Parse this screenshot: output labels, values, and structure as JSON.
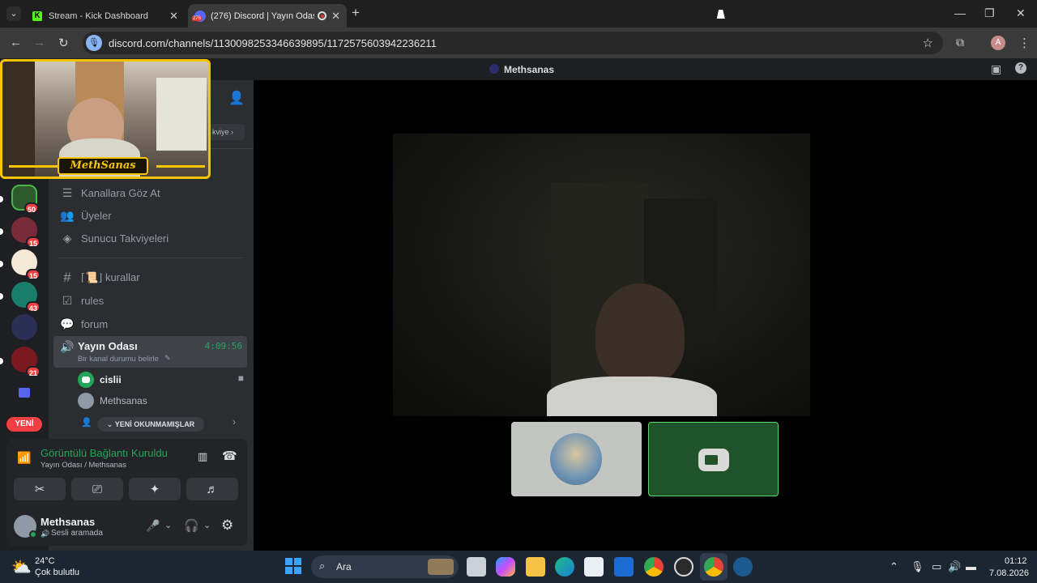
{
  "browser": {
    "tabs": [
      {
        "title": "Stream - Kick Dashboard",
        "active": false
      },
      {
        "title": "(276) Discord | Yayın Odası |",
        "badge": "276",
        "active": true
      }
    ],
    "url": "discord.com/channels/1130098253346639895/1172575603942236211",
    "profile_initial": "A"
  },
  "discord": {
    "header_title": "Methsanas",
    "boost_hint": "kviye",
    "webcam_overlay_label": "MethSanas",
    "guild_badges": [
      "50",
      "15",
      "15",
      "43",
      "21"
    ],
    "new_pill": "YENİ",
    "channels": [
      {
        "icon": "browse-icon",
        "label": "Kanallara Göz At"
      },
      {
        "icon": "members-icon",
        "label": "Üyeler"
      },
      {
        "icon": "boost-icon",
        "label": "Sunucu Takviyeleri"
      },
      {
        "icon": "hash-icon",
        "label": "⌈📜⌋ kurallar"
      },
      {
        "icon": "rules-icon",
        "label": "rules"
      },
      {
        "icon": "forum-icon",
        "label": "forum"
      }
    ],
    "voice_channel": {
      "name": "Yayın Odası",
      "timer": "4:09:56",
      "status_placeholder": "Bir kanal durumu belirle",
      "members": [
        "cislii",
        "Methsanas"
      ]
    },
    "unread_pill": "YENİ OKUNMAMIŞLAR",
    "voice_status": {
      "title": "Görüntülü Bağlantı Kuruldu",
      "subtitle": "Yayın Odası / Methsanas"
    },
    "user": {
      "name": "Methsanas",
      "status": "Sesli aramada"
    },
    "colors": {
      "accent_green": "#23a559",
      "blurple": "#5865f2",
      "danger": "#f23f43",
      "webcam_frame": "#f6c400"
    }
  },
  "taskbar": {
    "weather_temp": "24°C",
    "weather_desc": "Çok bulutlu",
    "search_label": "Ara",
    "time": "01:12",
    "date": "7.08.2026"
  }
}
